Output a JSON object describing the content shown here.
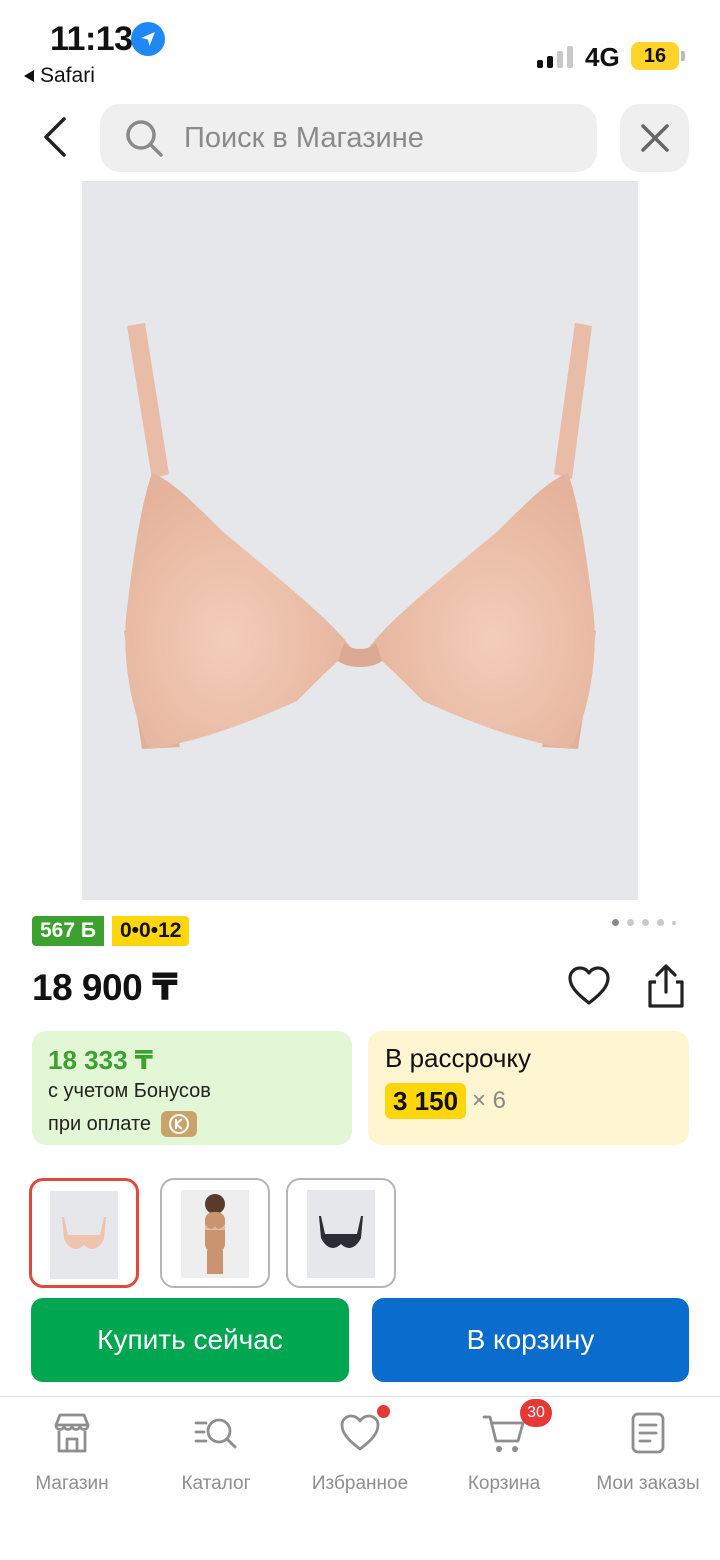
{
  "status_bar": {
    "time": "11:13",
    "back_app": "Safari",
    "network": "4G",
    "battery": "16"
  },
  "header": {
    "search_placeholder": "Поиск в Магазине"
  },
  "product": {
    "bonus_badge": "567 Б",
    "installment_badge": "0•0•12",
    "price": "18 900 ₸",
    "image_count": 5,
    "active_image": 1,
    "bonus_card": {
      "amount": "18 333 ₸",
      "line1": "с учетом Бонусов",
      "line2": "при оплате"
    },
    "installment_card": {
      "title": "В рассрочку",
      "amount": "3 150",
      "multiplier": "× 6"
    }
  },
  "variants": [
    {
      "name": "beige-bra",
      "selected": true
    },
    {
      "name": "model-beige-bra",
      "selected": false
    },
    {
      "name": "black-bra",
      "selected": false
    }
  ],
  "actions": {
    "buy_now": "Купить сейчас",
    "add_to_cart": "В корзину"
  },
  "tabbar": {
    "items": [
      {
        "label": "Магазин",
        "icon": "store-icon"
      },
      {
        "label": "Каталог",
        "icon": "catalog-search-icon"
      },
      {
        "label": "Избранное",
        "icon": "heart-icon"
      },
      {
        "label": "Корзина",
        "icon": "cart-icon",
        "badge": "30"
      },
      {
        "label": "Мои заказы",
        "icon": "orders-icon"
      }
    ]
  },
  "colors": {
    "green": "#00a650",
    "blue": "#0a6ccc",
    "yellow": "#ffd60a",
    "bonus_green": "#3ca12e",
    "badge_red": "#e53935"
  }
}
